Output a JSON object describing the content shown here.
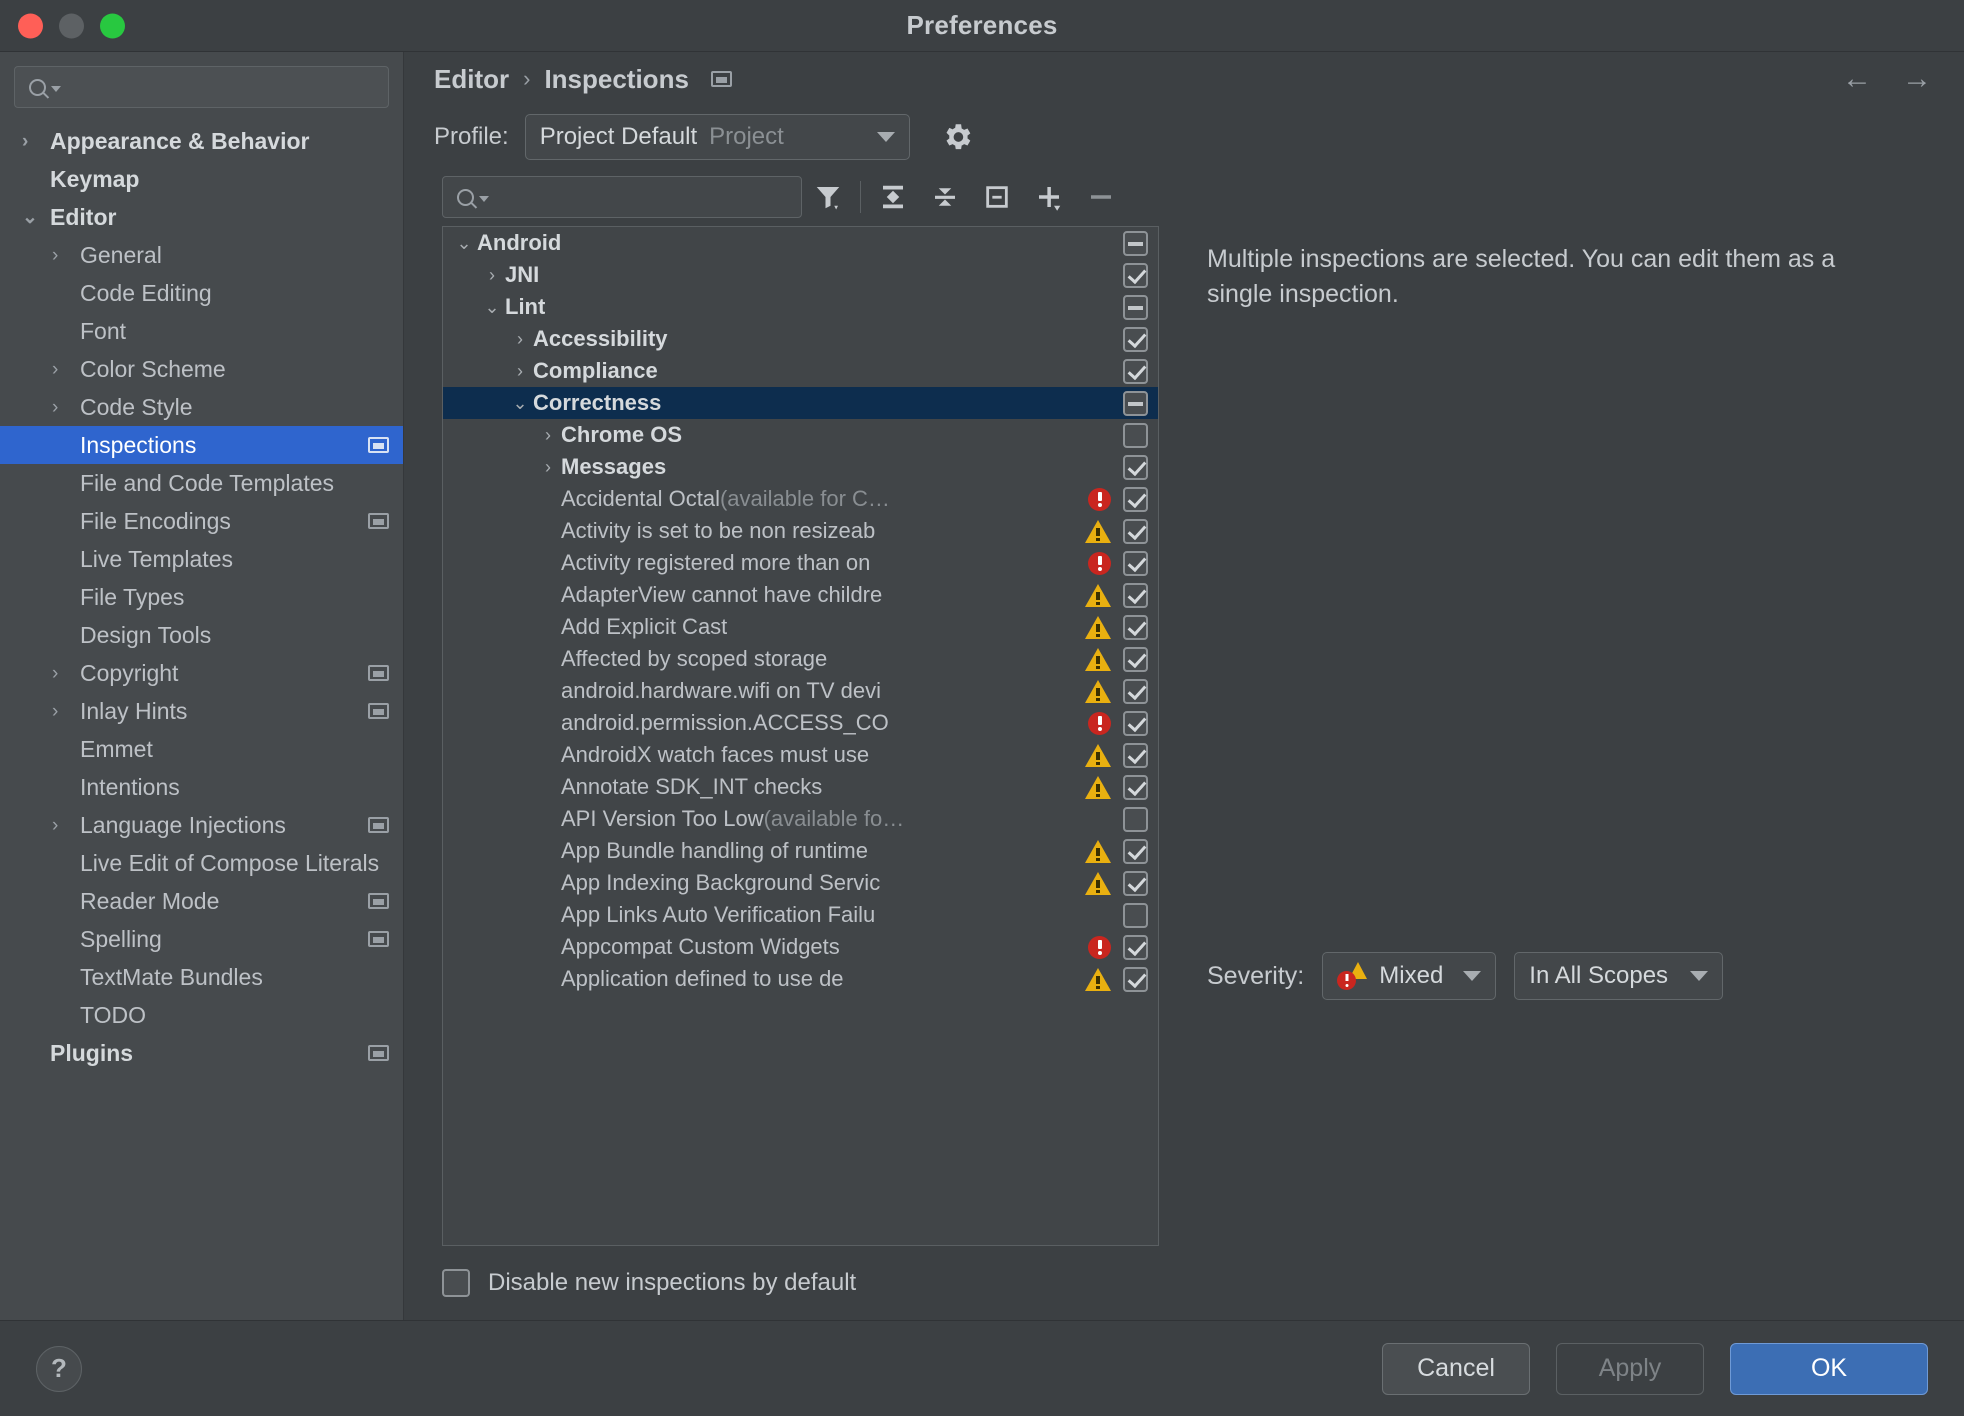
{
  "window": {
    "title": "Preferences",
    "traffic_lights": [
      "close",
      "minimize",
      "maximize"
    ]
  },
  "sidebar": {
    "search_placeholder": "",
    "items": [
      {
        "label": "Appearance & Behavior",
        "arrow": "›",
        "bold": true,
        "depth": 0,
        "badge": false,
        "selected": false
      },
      {
        "label": "Keymap",
        "arrow": "",
        "bold": true,
        "depth": 0,
        "badge": false,
        "selected": false
      },
      {
        "label": "Editor",
        "arrow": "⌄",
        "bold": true,
        "depth": 0,
        "badge": false,
        "selected": false
      },
      {
        "label": "General",
        "arrow": "›",
        "bold": false,
        "depth": 1,
        "badge": false,
        "selected": false
      },
      {
        "label": "Code Editing",
        "arrow": "",
        "bold": false,
        "depth": 1,
        "badge": false,
        "selected": false
      },
      {
        "label": "Font",
        "arrow": "",
        "bold": false,
        "depth": 1,
        "badge": false,
        "selected": false
      },
      {
        "label": "Color Scheme",
        "arrow": "›",
        "bold": false,
        "depth": 1,
        "badge": false,
        "selected": false
      },
      {
        "label": "Code Style",
        "arrow": "›",
        "bold": false,
        "depth": 1,
        "badge": false,
        "selected": false
      },
      {
        "label": "Inspections",
        "arrow": "",
        "bold": false,
        "depth": 1,
        "badge": true,
        "selected": true
      },
      {
        "label": "File and Code Templates",
        "arrow": "",
        "bold": false,
        "depth": 1,
        "badge": false,
        "selected": false
      },
      {
        "label": "File Encodings",
        "arrow": "",
        "bold": false,
        "depth": 1,
        "badge": true,
        "selected": false
      },
      {
        "label": "Live Templates",
        "arrow": "",
        "bold": false,
        "depth": 1,
        "badge": false,
        "selected": false
      },
      {
        "label": "File Types",
        "arrow": "",
        "bold": false,
        "depth": 1,
        "badge": false,
        "selected": false
      },
      {
        "label": "Design Tools",
        "arrow": "",
        "bold": false,
        "depth": 1,
        "badge": false,
        "selected": false
      },
      {
        "label": "Copyright",
        "arrow": "›",
        "bold": false,
        "depth": 1,
        "badge": true,
        "selected": false
      },
      {
        "label": "Inlay Hints",
        "arrow": "›",
        "bold": false,
        "depth": 1,
        "badge": true,
        "selected": false
      },
      {
        "label": "Emmet",
        "arrow": "",
        "bold": false,
        "depth": 1,
        "badge": false,
        "selected": false
      },
      {
        "label": "Intentions",
        "arrow": "",
        "bold": false,
        "depth": 1,
        "badge": false,
        "selected": false
      },
      {
        "label": "Language Injections",
        "arrow": "›",
        "bold": false,
        "depth": 1,
        "badge": true,
        "selected": false
      },
      {
        "label": "Live Edit of Compose Literals",
        "arrow": "",
        "bold": false,
        "depth": 1,
        "badge": false,
        "selected": false
      },
      {
        "label": "Reader Mode",
        "arrow": "",
        "bold": false,
        "depth": 1,
        "badge": true,
        "selected": false
      },
      {
        "label": "Spelling",
        "arrow": "",
        "bold": false,
        "depth": 1,
        "badge": true,
        "selected": false
      },
      {
        "label": "TextMate Bundles",
        "arrow": "",
        "bold": false,
        "depth": 1,
        "badge": false,
        "selected": false
      },
      {
        "label": "TODO",
        "arrow": "",
        "bold": false,
        "depth": 1,
        "badge": false,
        "selected": false
      },
      {
        "label": "Plugins",
        "arrow": "",
        "bold": true,
        "depth": 0,
        "badge": true,
        "selected": false
      }
    ]
  },
  "breadcrumb": {
    "parent": "Editor",
    "separator": "›",
    "current": "Inspections"
  },
  "nav": {
    "back": "←",
    "forward": "→"
  },
  "profile": {
    "label": "Profile:",
    "value": "Project Default",
    "scope": "Project",
    "settings_icon": "gear-icon"
  },
  "toolbar": {
    "search_placeholder": "",
    "buttons": [
      {
        "name": "filter-icon",
        "title": "Filter inspections"
      },
      {
        "name": "expand-all-icon",
        "title": "Expand All"
      },
      {
        "name": "collapse-all-icon",
        "title": "Collapse All"
      },
      {
        "name": "reset-group-icon",
        "title": "Reset to Empty"
      },
      {
        "name": "add-icon",
        "title": "Add"
      },
      {
        "name": "remove-icon",
        "title": "Remove"
      }
    ]
  },
  "tree": {
    "rows": [
      {
        "label": "Android",
        "suffix": "",
        "depth": 0,
        "arrow": "⌄",
        "group": true,
        "check": "partial",
        "severity": "none",
        "selected": false
      },
      {
        "label": "JNI",
        "suffix": "",
        "depth": 1,
        "arrow": "›",
        "group": true,
        "check": "checked",
        "severity": "none",
        "selected": false
      },
      {
        "label": "Lint",
        "suffix": "",
        "depth": 1,
        "arrow": "⌄",
        "group": true,
        "check": "partial",
        "severity": "none",
        "selected": false
      },
      {
        "label": "Accessibility",
        "suffix": "",
        "depth": 2,
        "arrow": "›",
        "group": true,
        "check": "checked",
        "severity": "none",
        "selected": false
      },
      {
        "label": "Compliance",
        "suffix": "",
        "depth": 2,
        "arrow": "›",
        "group": true,
        "check": "checked",
        "severity": "none",
        "selected": false
      },
      {
        "label": "Correctness",
        "suffix": "",
        "depth": 2,
        "arrow": "⌄",
        "group": true,
        "check": "partial",
        "severity": "none",
        "selected": true
      },
      {
        "label": "Chrome OS",
        "suffix": "",
        "depth": 3,
        "arrow": "›",
        "group": true,
        "check": "unchecked",
        "severity": "none",
        "selected": false
      },
      {
        "label": "Messages",
        "suffix": "",
        "depth": 3,
        "arrow": "›",
        "group": true,
        "check": "checked",
        "severity": "none",
        "selected": false
      },
      {
        "label": "Accidental Octal",
        "suffix": " (available for C…",
        "depth": 3,
        "arrow": "",
        "group": false,
        "check": "checked",
        "severity": "error",
        "selected": false
      },
      {
        "label": "Activity is set to be non resizeab",
        "suffix": "",
        "depth": 3,
        "arrow": "",
        "group": false,
        "check": "checked",
        "severity": "warning",
        "selected": false
      },
      {
        "label": "Activity registered more than on",
        "suffix": "",
        "depth": 3,
        "arrow": "",
        "group": false,
        "check": "checked",
        "severity": "error",
        "selected": false
      },
      {
        "label": "AdapterView cannot have childre",
        "suffix": "",
        "depth": 3,
        "arrow": "",
        "group": false,
        "check": "checked",
        "severity": "warning",
        "selected": false
      },
      {
        "label": "Add Explicit Cast",
        "suffix": "",
        "depth": 3,
        "arrow": "",
        "group": false,
        "check": "checked",
        "severity": "warning",
        "selected": false
      },
      {
        "label": "Affected by scoped storage",
        "suffix": "",
        "depth": 3,
        "arrow": "",
        "group": false,
        "check": "checked",
        "severity": "warning",
        "selected": false
      },
      {
        "label": "android.hardware.wifi on TV devi",
        "suffix": "",
        "depth": 3,
        "arrow": "",
        "group": false,
        "check": "checked",
        "severity": "warning",
        "selected": false
      },
      {
        "label": "android.permission.ACCESS_CO",
        "suffix": "",
        "depth": 3,
        "arrow": "",
        "group": false,
        "check": "checked",
        "severity": "error",
        "selected": false
      },
      {
        "label": "AndroidX watch faces must use ",
        "suffix": "",
        "depth": 3,
        "arrow": "",
        "group": false,
        "check": "checked",
        "severity": "warning",
        "selected": false
      },
      {
        "label": "Annotate SDK_INT checks",
        "suffix": "",
        "depth": 3,
        "arrow": "",
        "group": false,
        "check": "checked",
        "severity": "warning",
        "selected": false
      },
      {
        "label": "API Version Too Low",
        "suffix": " (available fo…",
        "depth": 3,
        "arrow": "",
        "group": false,
        "check": "unchecked",
        "severity": "none",
        "selected": false
      },
      {
        "label": "App Bundle handling of runtime ",
        "suffix": "",
        "depth": 3,
        "arrow": "",
        "group": false,
        "check": "checked",
        "severity": "warning",
        "selected": false
      },
      {
        "label": "App Indexing Background Servic",
        "suffix": "",
        "depth": 3,
        "arrow": "",
        "group": false,
        "check": "checked",
        "severity": "warning",
        "selected": false
      },
      {
        "label": "App Links Auto Verification Failu",
        "suffix": "",
        "depth": 3,
        "arrow": "",
        "group": false,
        "check": "unchecked",
        "severity": "none",
        "selected": false
      },
      {
        "label": "Appcompat Custom Widgets",
        "suffix": "",
        "depth": 3,
        "arrow": "",
        "group": false,
        "check": "checked",
        "severity": "error",
        "selected": false
      },
      {
        "label": "Application defined to use de",
        "suffix": "",
        "depth": 3,
        "arrow": "",
        "group": false,
        "check": "checked",
        "severity": "warning",
        "selected": false
      }
    ]
  },
  "disable_new": {
    "label": "Disable new inspections by default",
    "checked": false
  },
  "detail": {
    "message": "Multiple inspections are selected. You can edit them as a single inspection.",
    "severity_label": "Severity:",
    "severity_value": "Mixed",
    "scope_value": "In All Scopes"
  },
  "footer": {
    "help": "?",
    "cancel": "Cancel",
    "apply": "Apply",
    "ok": "OK"
  },
  "colors": {
    "window_bg": "#3c4043",
    "sidebar_bg": "#464a4d",
    "selection_blue": "#2f65ce",
    "tree_selection": "#0d2d4e",
    "accent_ok": "#3c6eb4",
    "error_red": "#c9261f",
    "warning_yellow": "#e9b010"
  }
}
